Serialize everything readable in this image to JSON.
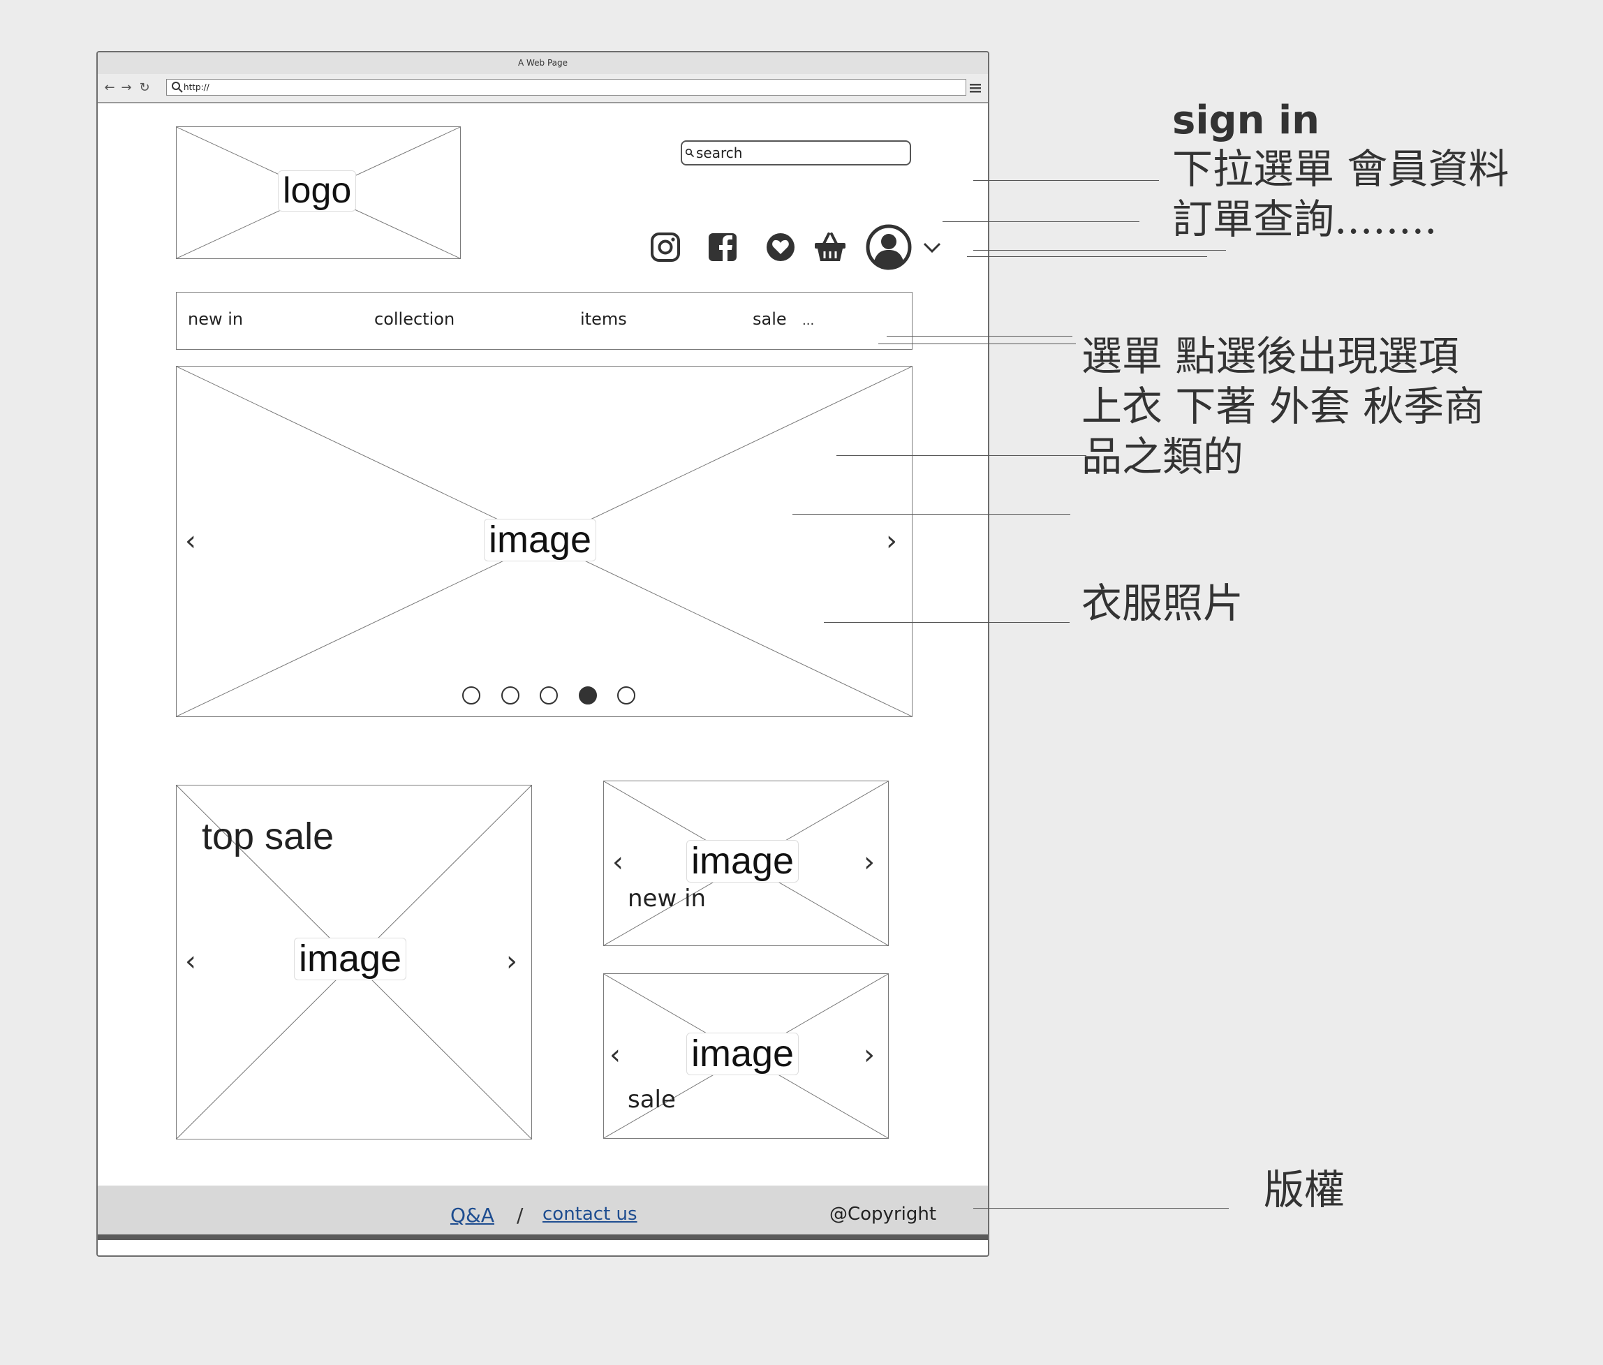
{
  "browser": {
    "title": "A Web Page",
    "url": "http://"
  },
  "header": {
    "logo_label": "logo",
    "search_placeholder": "search"
  },
  "nav": {
    "items": [
      "new in",
      "collection",
      "items",
      "sale",
      "..."
    ]
  },
  "hero": {
    "image_label": "image",
    "dots": 5,
    "active_dot": 4
  },
  "tiles": {
    "top_sale": {
      "title": "top sale",
      "image_label": "image"
    },
    "new_in": {
      "caption": "new in",
      "image_label": "image"
    },
    "sale": {
      "caption": "sale",
      "image_label": "image"
    }
  },
  "footer": {
    "qa": "Q&A",
    "separator": "/",
    "contact": "contact us",
    "copyright": "@Copyright"
  },
  "annotations": {
    "sign_in_title": "sign in",
    "sign_in_line1": "下拉選單 會員資料",
    "sign_in_line2": "訂單查詢........",
    "menu_line1": "選單 點選後出現選項",
    "menu_line2": "上衣 下著 外套 秋季商",
    "menu_line3": "品之類的",
    "photo": "衣服照片",
    "copyright": "版權"
  },
  "icons": [
    "instagram-icon",
    "facebook-icon",
    "heart-icon",
    "basket-icon",
    "user-icon",
    "chevron-down-icon"
  ]
}
